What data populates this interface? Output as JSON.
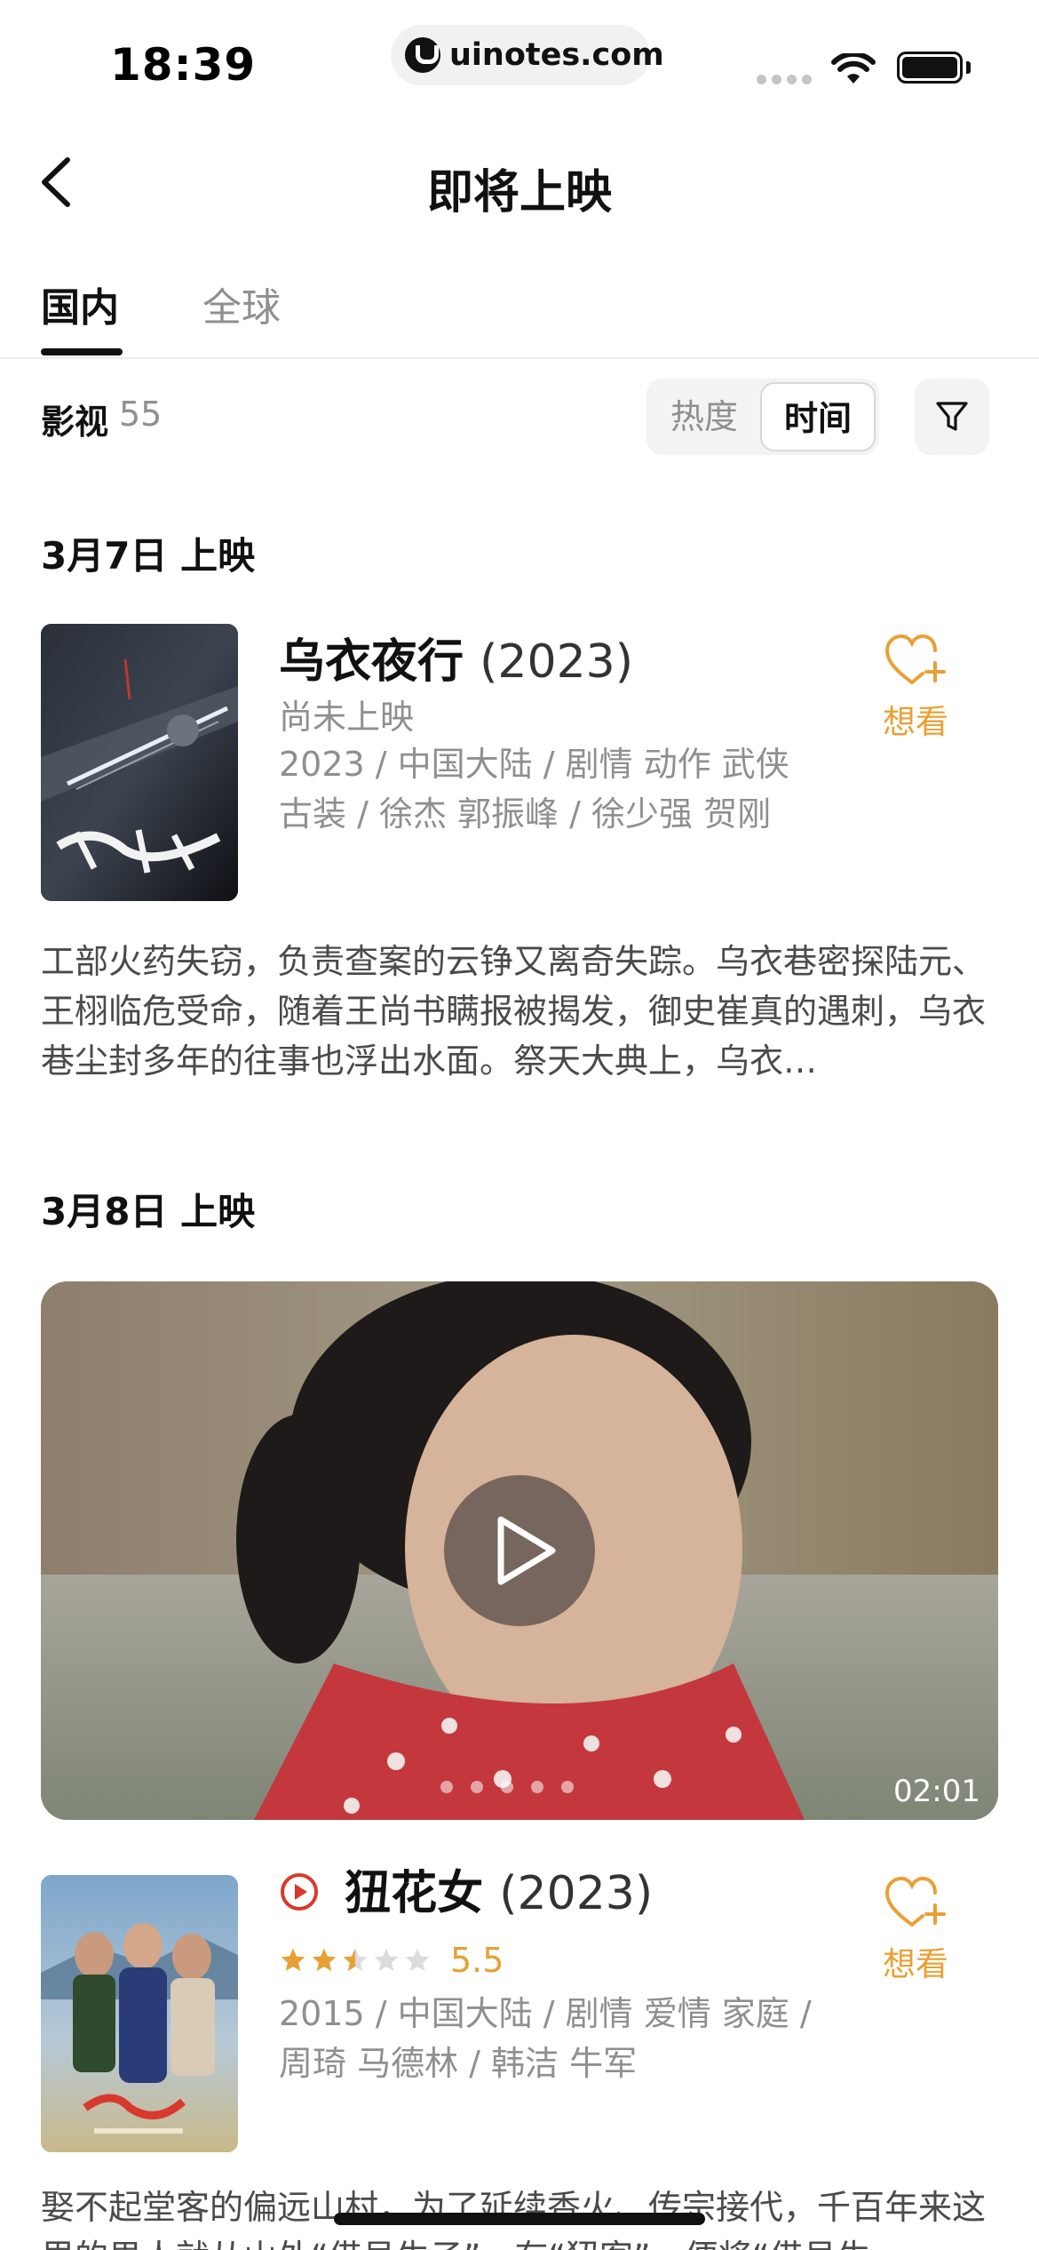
{
  "status_bar": {
    "time": "18:39",
    "url": "uinotes.com"
  },
  "nav": {
    "title": "即将上映"
  },
  "tabs": [
    {
      "label": "国内",
      "active": true
    },
    {
      "label": "全球",
      "active": false
    }
  ],
  "filter": {
    "category_label": "影视",
    "count": "55",
    "sort_options": [
      {
        "label": "热度",
        "active": false
      },
      {
        "label": "时间",
        "active": true
      }
    ]
  },
  "sections": [
    {
      "date": "3月7日 上映",
      "movie": {
        "title": "乌衣夜行",
        "year": "(2023)",
        "status": "尚未上映",
        "meta_line1": "2023 / 中国大陆 / 剧情 动作 武侠",
        "meta_line2": "古装 / 徐杰 郭振峰 / 徐少强 贺刚",
        "want_label": "想看",
        "synopsis": "工部火药失窃，负责查案的云铮又离奇失踪。乌衣巷密探陆元、王栩临危受命，随着王尚书瞒报被揭发，御史崔真的遇刺，乌衣巷尘封多年的往事也浮出水面。祭天大典上，乌衣…"
      }
    },
    {
      "date": "3月8日 上映",
      "video": {
        "duration": "02:01"
      },
      "movie": {
        "title": "狃花女",
        "year": "(2023)",
        "rating": "5.5",
        "stars": 2.5,
        "meta_line1": "2015 / 中国大陆 / 剧情 爱情 家庭 /",
        "meta_line2": "周琦 马德林 / 韩洁 牛军",
        "want_label": "想看",
        "synopsis": "娶不起堂客的偏远山村，为了延续香火、传宗接代，千百年来这里的男人就从山外“借号生子”，有“狃客”，便将“借号生…"
      }
    }
  ],
  "colors": {
    "accent": "#e9a035",
    "play_red": "#d9382e",
    "text_primary": "#111111",
    "text_secondary": "#8f8f8f"
  }
}
